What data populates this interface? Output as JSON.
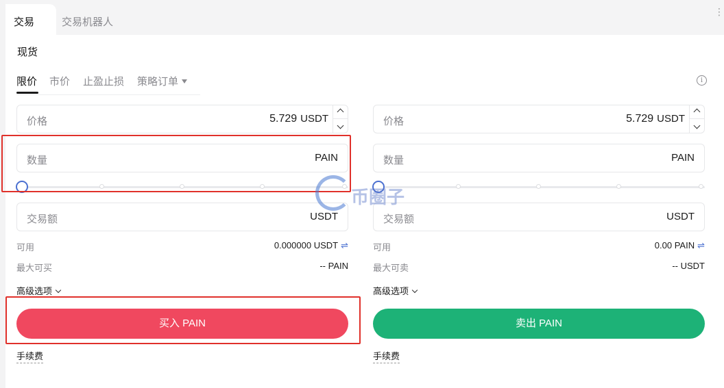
{
  "tabs": {
    "active": "交易",
    "bot": "交易机器人"
  },
  "spot_label": "现货",
  "order_types": [
    "限价",
    "市价",
    "止盈止损",
    "策略订单"
  ],
  "buy": {
    "price_label": "价格",
    "price_value": "5.729",
    "price_unit": "USDT",
    "qty_label": "数量",
    "qty_unit": "PAIN",
    "total_label": "交易额",
    "total_unit": "USDT",
    "avail_label": "可用",
    "avail_value": "0.000000 USDT",
    "max_label": "最大可买",
    "max_value": "-- PAIN",
    "adv_label": "高级选项",
    "button_label": "买入 PAIN",
    "fee_label": "手续费",
    "slider_fraction": 0
  },
  "sell": {
    "price_label": "价格",
    "price_value": "5.729",
    "price_unit": "USDT",
    "qty_label": "数量",
    "qty_unit": "PAIN",
    "total_label": "交易额",
    "total_unit": "USDT",
    "avail_label": "可用",
    "avail_value": "0.00 PAIN",
    "max_label": "最大可卖",
    "max_value": "-- USDT",
    "adv_label": "高级选项",
    "button_label": "卖出 PAIN",
    "fee_label": "手续费",
    "slider_fraction": 0
  },
  "watermark": "币圈子",
  "colors": {
    "buy": "#f0485f",
    "sell": "#1db277",
    "accent": "#4a6fd0",
    "highlight": "#e0302a"
  }
}
